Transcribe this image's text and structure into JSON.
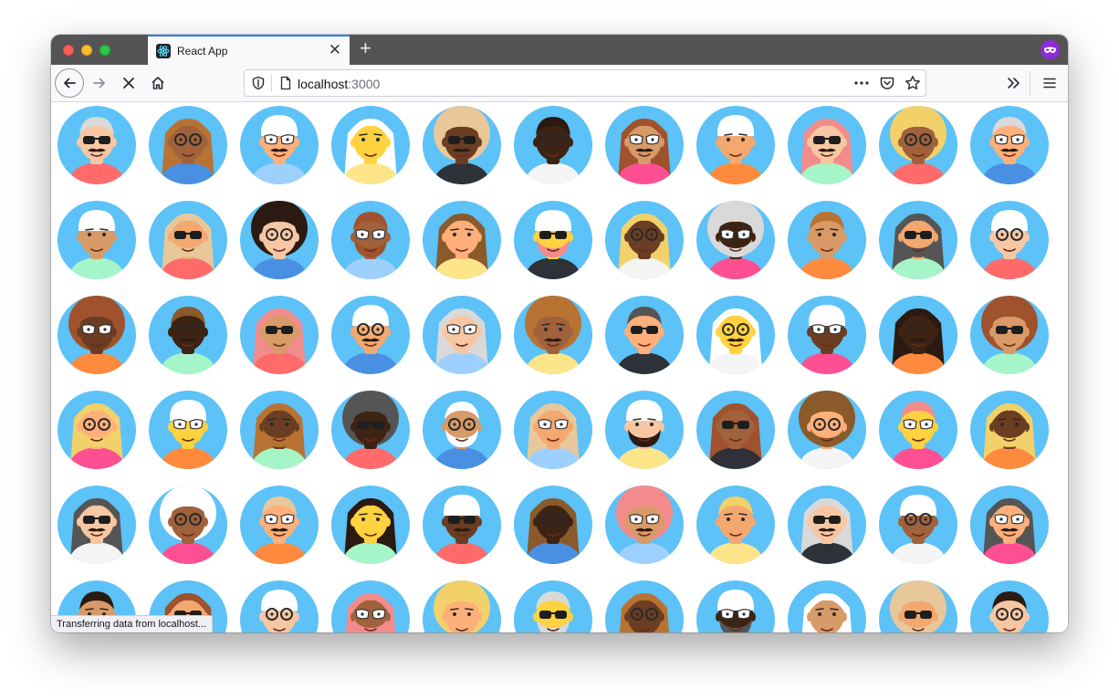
{
  "browser": {
    "tab": {
      "title": "React App",
      "icon": "react-logo-icon"
    },
    "address_bar": {
      "host": "localhost",
      "port": ":3000"
    },
    "status_text": "Transferring data from localhost..."
  },
  "theme": {
    "avatar_background": "#5cc2f7",
    "tab_accent": "#2e7cf6",
    "private_badge": "#8c2bd8"
  },
  "avatars": {
    "rows": 6,
    "columns": 11,
    "skin_tones": [
      "#f7c7a3",
      "#ffd23f",
      "#d89a67",
      "#a0613b",
      "#6b3d22",
      "#f4a86f",
      "#ffb07a",
      "#3d2313"
    ],
    "hair_colors": [
      "#d9d9d9",
      "#f2d16b",
      "#f28c8c",
      "#8b5a2b",
      "#a0522d",
      "#2b1a12",
      "#e8c89a",
      "#ffffff",
      "#555555",
      "#b87333"
    ],
    "shirt_colors": [
      "#ff6b6b",
      "#9ed0ff",
      "#2e3138",
      "#ff4f93",
      "#a5f5c8",
      "#4a90e2",
      "#ffe58a",
      "#f5f5f5",
      "#ff8a3d"
    ]
  }
}
